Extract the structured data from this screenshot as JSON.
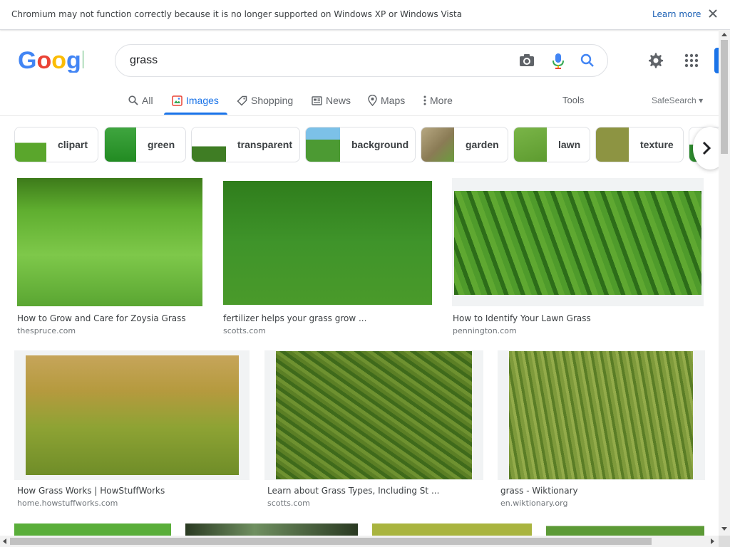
{
  "infobar": {
    "message": "Chromium may not function correctly because it is no longer supported on Windows XP or Windows Vista",
    "learn_more": "Learn more"
  },
  "logo": {
    "text": "Google"
  },
  "search": {
    "query": "grass"
  },
  "tabs": [
    {
      "label": "All",
      "icon": "search-icon",
      "active": false
    },
    {
      "label": "Images",
      "icon": "image-icon",
      "active": true
    },
    {
      "label": "Shopping",
      "icon": "tag-icon",
      "active": false
    },
    {
      "label": "News",
      "icon": "news-icon",
      "active": false
    },
    {
      "label": "Maps",
      "icon": "map-pin-icon",
      "active": false
    },
    {
      "label": "More",
      "icon": "more-vertical-icon",
      "active": false
    }
  ],
  "tools_label": "Tools",
  "safesearch_label": "SafeSearch",
  "chips": [
    {
      "label": "clipart",
      "thumb_color": "#5aa62c"
    },
    {
      "label": "green",
      "thumb_color": "#2e9a2e"
    },
    {
      "label": "transparent",
      "thumb_color": "#3f7d24"
    },
    {
      "label": "background",
      "thumb_color": "#4c9a33"
    },
    {
      "label": "garden",
      "thumb_color": "#8a7b55"
    },
    {
      "label": "lawn",
      "thumb_color": "#5d9b2f"
    },
    {
      "label": "texture",
      "thumb_color": "#8d9442"
    }
  ],
  "results": [
    {
      "title": "How to Grow and Care for Zoysia Grass",
      "source": "thespruce.com",
      "color_top": "#3d7a1a",
      "color_bottom": "#7ec84a"
    },
    {
      "title": "fertilizer helps your grass grow ...",
      "source": "scotts.com",
      "color_top": "#2f7d1c",
      "color_bottom": "#4a9a2a"
    },
    {
      "title": "How to Identify Your Lawn Grass",
      "source": "pennington.com",
      "color_top": "#4f9b2b",
      "color_bottom": "#2d6d19"
    },
    {
      "title": "How Grass Works | HowStuffWorks",
      "source": "home.howstuffworks.com",
      "color_top": "#b59a3e",
      "color_bottom": "#6f8d28"
    },
    {
      "title": "Learn about Grass Types, Including St ...",
      "source": "scotts.com",
      "color_top": "#5b7f25",
      "color_bottom": "#3f6a1b"
    },
    {
      "title": "grass - Wiktionary",
      "source": "en.wiktionary.org",
      "color_top": "#7e9a3b",
      "color_bottom": "#5a7d26"
    }
  ],
  "bottom_row_colors": [
    "#5aae3a",
    "#2a3a22",
    "#a9b43f",
    "#5c9a36"
  ]
}
